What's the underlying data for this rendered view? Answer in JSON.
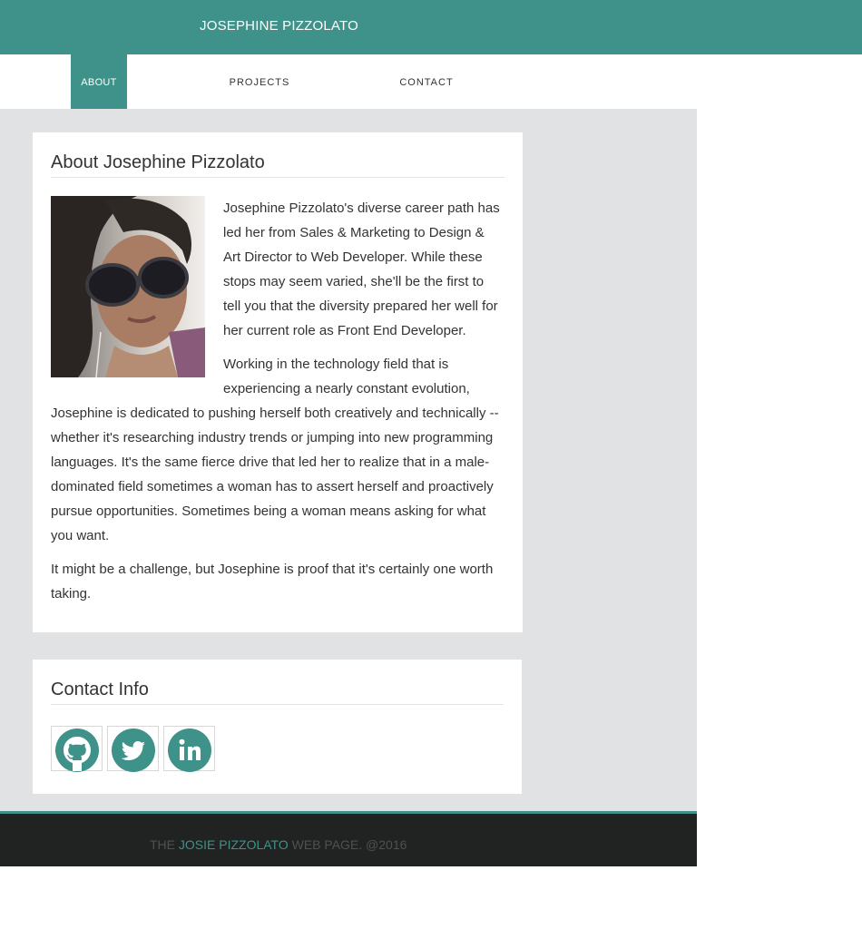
{
  "header": {
    "site_title": "JOSEPHINE PIZZOLATO"
  },
  "nav": {
    "items": [
      {
        "label": "ABOUT",
        "active": true
      },
      {
        "label": "PROJECTS",
        "active": false
      },
      {
        "label": "CONTACT",
        "active": false
      }
    ]
  },
  "about": {
    "heading": "About Josephine Pizzolato",
    "paragraphs": [
      "Josephine Pizzolato's diverse career path has led her from Sales & Marketing to Design & Art Director to Web Developer. While these stops may seem varied, she'll be the first to tell you that the diversity prepared her well for her current role as Front End Developer.",
      "Working in the technology field that is experiencing a nearly constant evolution, Josephine is dedicated to pushing herself both creatively and technically -- whether it's researching industry trends or jumping into new programming languages. It's the same fierce drive that led her to realize that in a male-dominated field sometimes a woman has to assert herself and proactively pursue opportunities. Sometimes being a woman means asking for what you want.",
      "It might be a challenge, but Josephine is proof that it's certainly one worth taking."
    ]
  },
  "contact": {
    "heading": "Contact Info",
    "socials": [
      {
        "icon": "github-icon"
      },
      {
        "icon": "twitter-icon"
      },
      {
        "icon": "linkedin-icon"
      }
    ]
  },
  "footer": {
    "prefix": "THE ",
    "highlight": "JOSIE PIZZOLATO",
    "suffix": " WEB PAGE. @2016"
  },
  "colors": {
    "brand": "#3f9289",
    "footer_bg": "#212222",
    "content_bg": "#e1e2e4"
  }
}
